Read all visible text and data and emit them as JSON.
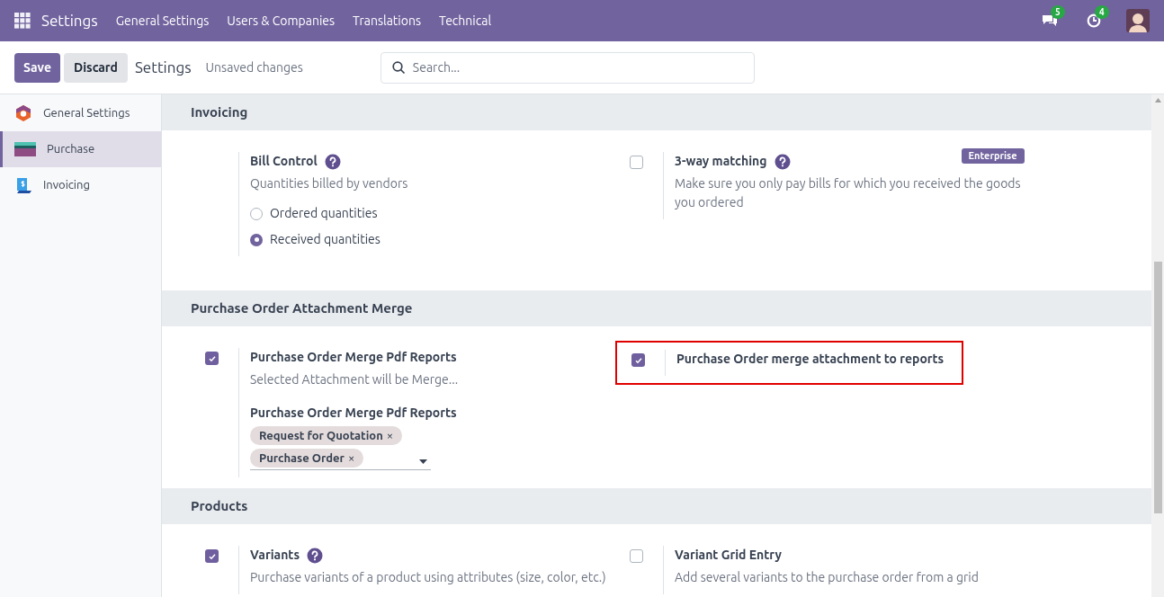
{
  "navbar": {
    "app_title": "Settings",
    "menu": [
      "General Settings",
      "Users & Companies",
      "Translations",
      "Technical"
    ],
    "messages_count": "5",
    "activities_count": "4"
  },
  "control_panel": {
    "save": "Save",
    "discard": "Discard",
    "title": "Settings",
    "status": "Unsaved changes",
    "search": {
      "placeholder": "Search..."
    }
  },
  "sidebar": {
    "items": [
      {
        "label": "General Settings",
        "selected": false
      },
      {
        "label": "Purchase",
        "selected": true
      },
      {
        "label": "Invoicing",
        "selected": false
      }
    ]
  },
  "sections": [
    {
      "title": "Invoicing",
      "settings": [
        {
          "kind": "radio",
          "title": "Bill Control",
          "help": true,
          "description": "Quantities billed by vendors",
          "options": [
            {
              "label": "Ordered quantities",
              "selected": false
            },
            {
              "label": "Received quantities",
              "selected": true
            }
          ]
        },
        {
          "kind": "checkbox",
          "checked": false,
          "title": "3-way matching",
          "help": true,
          "badge": "Enterprise",
          "description": "Make sure you only pay bills for which you received the goods you ordered"
        }
      ]
    },
    {
      "title": "Purchase Order Attachment Merge",
      "settings": [
        {
          "kind": "checkbox",
          "checked": true,
          "title": "Purchase Order Merge Pdf Reports",
          "description": "Selected Attachment will be Merge...",
          "field": {
            "label": "Purchase Order Merge Pdf Reports",
            "tags": [
              {
                "label": "Request for Quotation",
                "remove": "×"
              },
              {
                "label": "Purchase Order",
                "remove": "×"
              }
            ]
          }
        },
        {
          "kind": "checkbox",
          "checked": true,
          "title": "Purchase Order merge attachment to reports",
          "highlighted": true
        }
      ]
    },
    {
      "title": "Products",
      "settings": [
        {
          "kind": "checkbox",
          "checked": true,
          "title": "Variants",
          "help": true,
          "description": "Purchase variants of a product using attributes (size, color, etc.)"
        },
        {
          "kind": "checkbox",
          "checked": false,
          "title": "Variant Grid Entry",
          "description": "Add several variants to the purchase order from a grid"
        }
      ]
    }
  ]
}
